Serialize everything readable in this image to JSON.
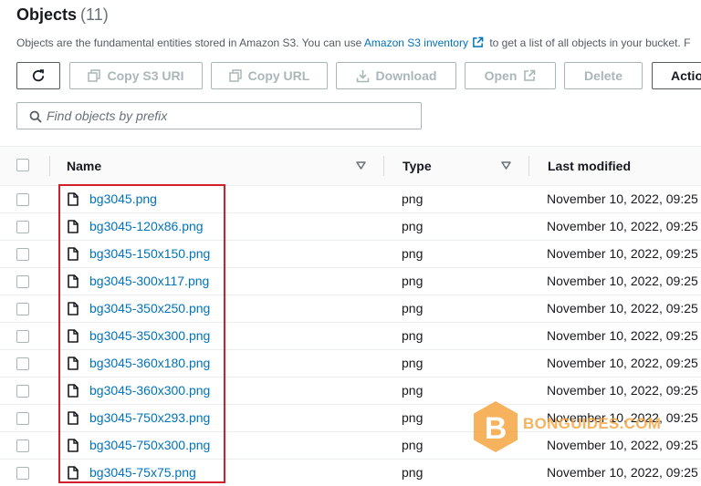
{
  "header": {
    "title": "Objects",
    "count": "(11)",
    "description_before": "Objects are the fundamental entities stored in Amazon S3. You can use ",
    "description_link": "Amazon S3 inventory",
    "description_after": " to get a list of all objects in your bucket. F"
  },
  "toolbar": {
    "refresh_label": "",
    "copy_s3_uri": "Copy S3 URI",
    "copy_url": "Copy URL",
    "download": "Download",
    "open": "Open",
    "delete": "Delete",
    "actions": "Actio"
  },
  "search": {
    "placeholder": "Find objects by prefix",
    "value": ""
  },
  "table": {
    "columns": {
      "name": "Name",
      "type": "Type",
      "last_modified": "Last modified"
    },
    "rows": [
      {
        "name": "bg3045.png",
        "type": "png",
        "last_modified": "November 10, 2022, 09:25"
      },
      {
        "name": "bg3045-120x86.png",
        "type": "png",
        "last_modified": "November 10, 2022, 09:25"
      },
      {
        "name": "bg3045-150x150.png",
        "type": "png",
        "last_modified": "November 10, 2022, 09:25"
      },
      {
        "name": "bg3045-300x117.png",
        "type": "png",
        "last_modified": "November 10, 2022, 09:25"
      },
      {
        "name": "bg3045-350x250.png",
        "type": "png",
        "last_modified": "November 10, 2022, 09:25"
      },
      {
        "name": "bg3045-350x300.png",
        "type": "png",
        "last_modified": "November 10, 2022, 09:25"
      },
      {
        "name": "bg3045-360x180.png",
        "type": "png",
        "last_modified": "November 10, 2022, 09:25"
      },
      {
        "name": "bg3045-360x300.png",
        "type": "png",
        "last_modified": "November 10, 2022, 09:25"
      },
      {
        "name": "bg3045-750x293.png",
        "type": "png",
        "last_modified": "November 10, 2022, 09:25"
      },
      {
        "name": "bg3045-750x300.png",
        "type": "png",
        "last_modified": "November 10, 2022, 09:25"
      },
      {
        "name": "bg3045-75x75.png",
        "type": "png",
        "last_modified": "November 10, 2022, 09:25"
      }
    ]
  },
  "watermark": {
    "letter": "B",
    "text": "BONGUIDES.COM"
  },
  "colors": {
    "link": "#0073bb",
    "disabled": "#aab7b8",
    "highlight": "#d0202a",
    "watermark": "#f5a23a"
  }
}
